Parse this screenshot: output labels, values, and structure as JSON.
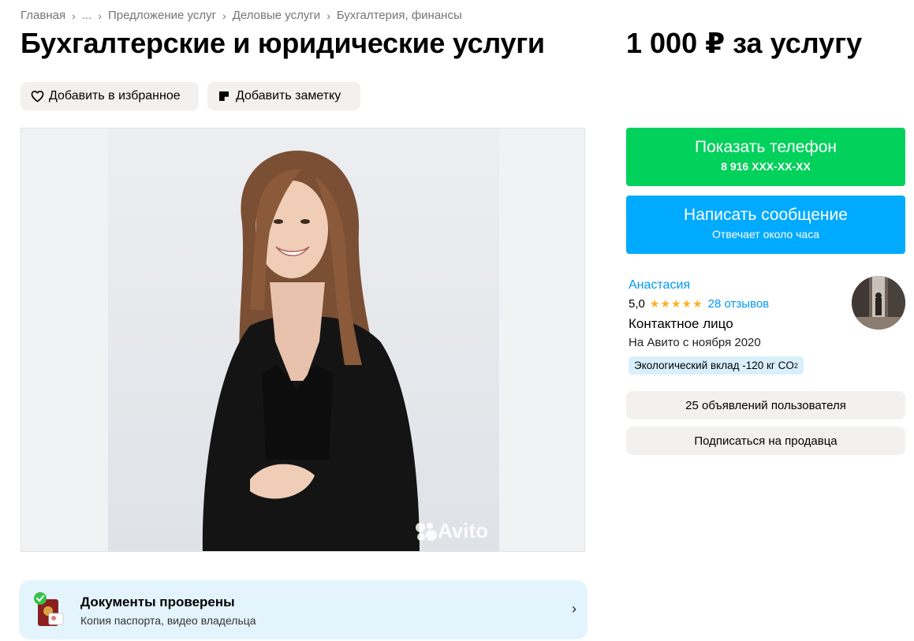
{
  "breadcrumb": {
    "items": [
      "Главная",
      "...",
      "Предложение услуг",
      "Деловые услуги",
      "Бухгалтерия, финансы"
    ],
    "separator": "›"
  },
  "listing": {
    "title": "Бухгалтерские и юридические услуги",
    "price": "1 000 ₽ за услугу"
  },
  "actions": {
    "favorite_label": "Добавить в избранное",
    "note_label": "Добавить заметку"
  },
  "gallery": {
    "watermark": "Avito"
  },
  "contact": {
    "phone_label": "Показать телефон",
    "phone_masked": "8 916 XXX-XX-XX",
    "message_label": "Написать сообщение",
    "message_sub": "Отвечает около часа",
    "phone_color": "#02d15c",
    "message_color": "#00aaff"
  },
  "seller": {
    "name": "Анастасия",
    "rating": "5,0",
    "stars": "★★★★★",
    "reviews": "28 отзывов",
    "role": "Контактное лицо",
    "since": "На Авито с ноября 2020",
    "eco_text": "Экологический вклад -120 кг CO",
    "eco_sub": "2",
    "ads_label": "25 объявлений пользователя",
    "subscribe_label": "Подписаться на продавца"
  },
  "documents": {
    "title": "Документы проверены",
    "subtitle": "Копия паспорта, видео владельца",
    "chevron": "›"
  },
  "icons": {
    "favorite": "heart-icon",
    "note": "note-icon",
    "documents": "passport-check-icon",
    "chevron": "chevron-right-icon"
  }
}
